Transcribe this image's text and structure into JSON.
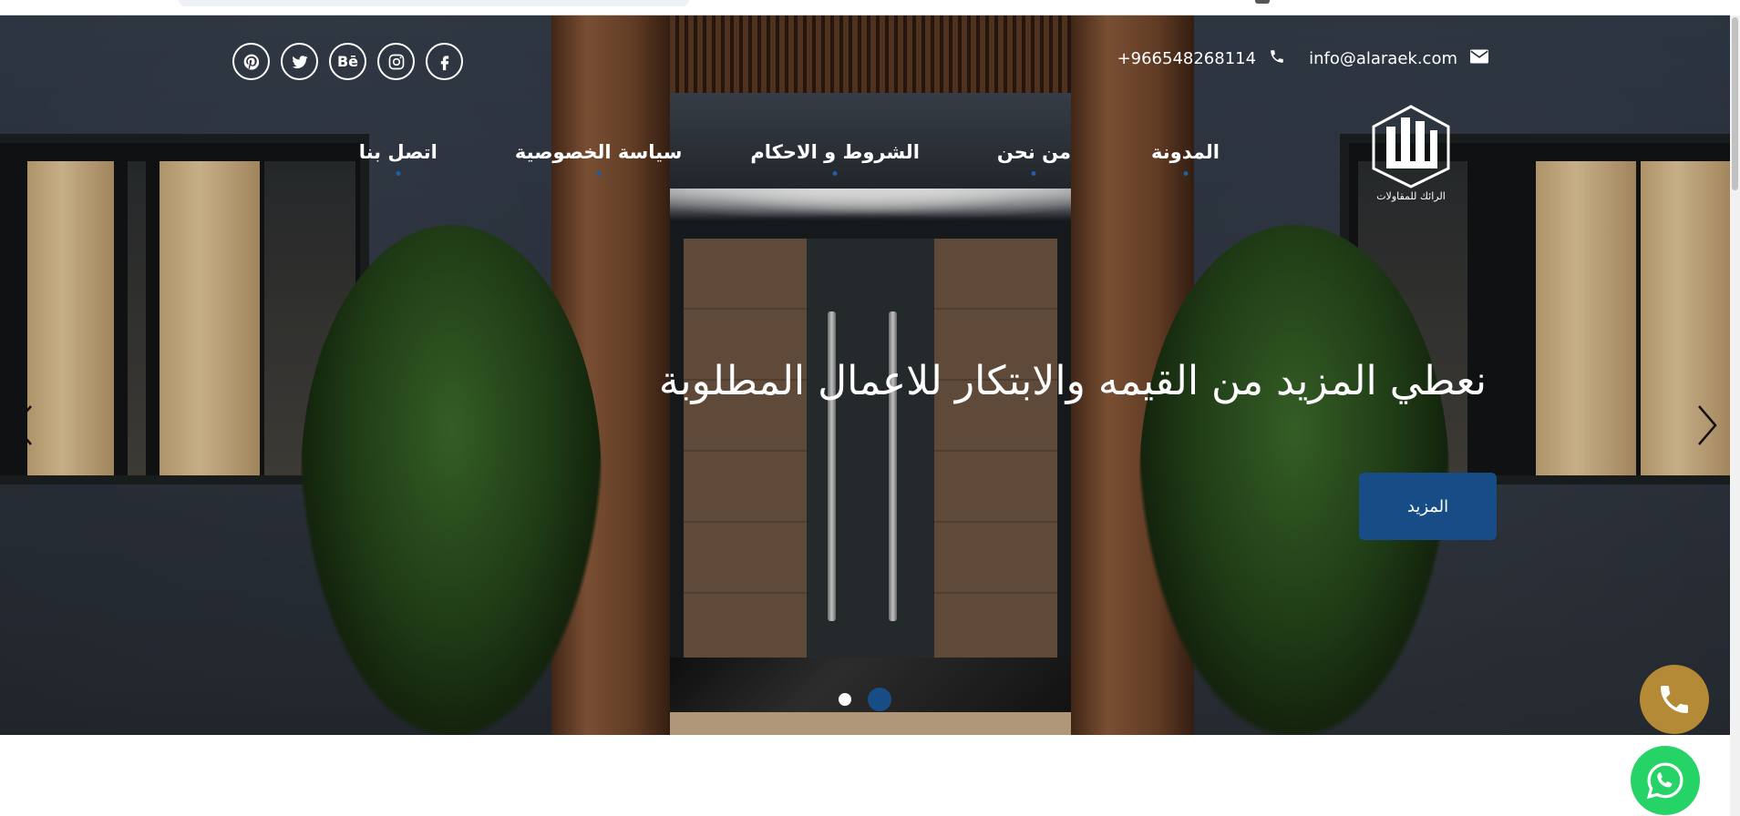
{
  "header": {
    "email": "info@alaraek.com",
    "phone": "+966548268114",
    "social": [
      "pinterest-icon",
      "twitter-icon",
      "behance-icon",
      "instagram-icon",
      "facebook-icon"
    ],
    "behance_label": "Bē"
  },
  "logo": {
    "caption": "الرائك للمقاولات"
  },
  "nav": {
    "items": [
      {
        "label": "المدونة"
      },
      {
        "label": "من نحن"
      },
      {
        "label": "الشروط و الاحكام"
      },
      {
        "label": "سياسة الخصوصية"
      },
      {
        "label": "اتصل بنا"
      }
    ]
  },
  "hero": {
    "headline": "نعطي المزيد من القيمه والابتكار للاعمال المطلوبة",
    "cta_label": "المزيد",
    "slides_total": 2,
    "active_slide": 2
  },
  "colors": {
    "accent": "#184c86",
    "call": "#b48a36",
    "whatsapp": "#25d366"
  }
}
